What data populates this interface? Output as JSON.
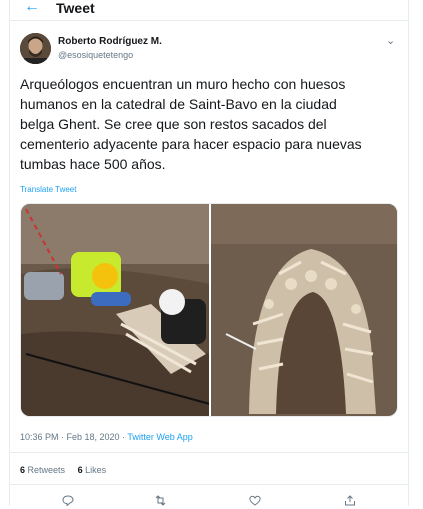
{
  "header": {
    "back_icon": "arrow-left-icon",
    "title": "Tweet"
  },
  "author": {
    "name": "Roberto Rodríguez M.",
    "handle": "@esosiquetetengo"
  },
  "tweet": {
    "text": "Arqueólogos encuentran un muro hecho con huesos\nhumanos en la catedral de Saint-Bavo en la ciudad\nbelga Ghent. Se cree que son restos sacados del\ncementerio adyacente para hacer espacio para nuevas\ntumbas hace 500 años.",
    "translate_label": "Translate Tweet",
    "timestamp": "10:36 PM · Feb 18, 2020 · ",
    "source": "Twitter Web App"
  },
  "stats": {
    "retweets_count": "6",
    "retweets_label": " Retweets",
    "likes_count": "6",
    "likes_label": " Likes"
  },
  "actions": [
    "reply-icon",
    "retweet-icon",
    "like-icon",
    "share-icon"
  ],
  "colors": {
    "accent": "#1da1f2",
    "text": "#14171a",
    "muted": "#657786",
    "border": "#e6ecf0"
  }
}
